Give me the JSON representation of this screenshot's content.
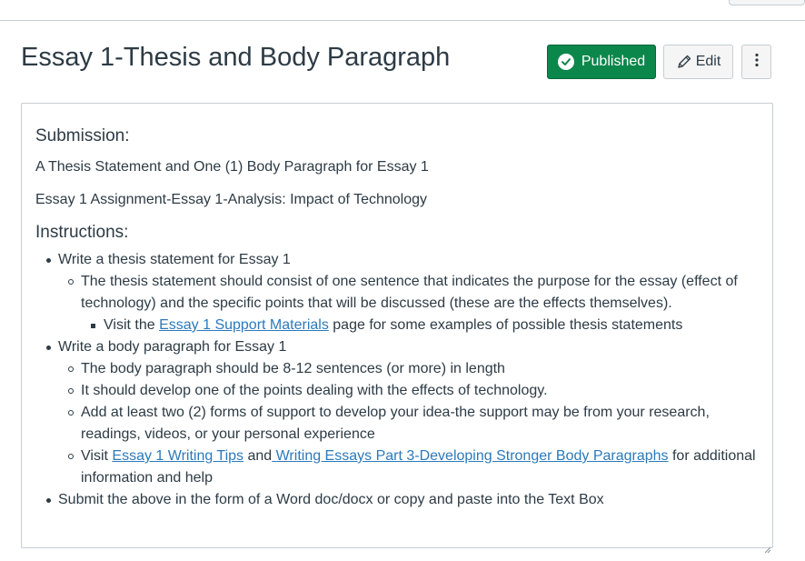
{
  "header": {
    "title": "Essay 1-Thesis and Body Paragraph",
    "published_label": "Published",
    "edit_label": "Edit",
    "more_label": "⋮"
  },
  "content": {
    "submission_heading": "Submission:",
    "submission_line1": "A Thesis Statement and One (1) Body Paragraph for Essay 1",
    "submission_line2": "Essay 1 Assignment-Essay 1-Analysis: Impact of Technology",
    "instructions_heading": "Instructions:",
    "item1": {
      "text": "Write a thesis statement for Essay 1",
      "sub1": "The thesis statement should consist of one sentence that indicates the purpose for the essay (effect of technology) and the specific points that will be discussed (these are the effects themselves).",
      "sub1_bullet": {
        "before": "Visit the ",
        "link": "Essay 1 Support Materials",
        "after": " page for some examples of possible thesis statements"
      }
    },
    "item2": {
      "text": "Write a body paragraph for Essay 1",
      "sub1": "The body paragraph should be 8-12 sentences (or more) in length",
      "sub2": "It should develop one of the points dealing with the effects of technology.",
      "sub3": "Add at least two (2) forms of support to develop your idea-the support may be from your research, readings, videos, or your personal experience",
      "sub4": {
        "before": "Visit ",
        "link1": "Essay 1 Writing Tips",
        "middle": " and",
        "link2": " Writing Essays Part 3-Developing Stronger Body Paragraphs",
        "after": " for additional information and help"
      }
    },
    "item3": {
      "text": "Submit the above in the form of a Word doc/docx or copy and paste into the Text Box"
    }
  },
  "colors": {
    "published_bg": "#0b874b",
    "link": "#2b7abc",
    "text": "#2d3b45",
    "border": "#c7cdd1"
  },
  "icons": {
    "published": "check-circle-icon",
    "edit": "pencil-icon",
    "more": "kebab-menu-icon"
  }
}
